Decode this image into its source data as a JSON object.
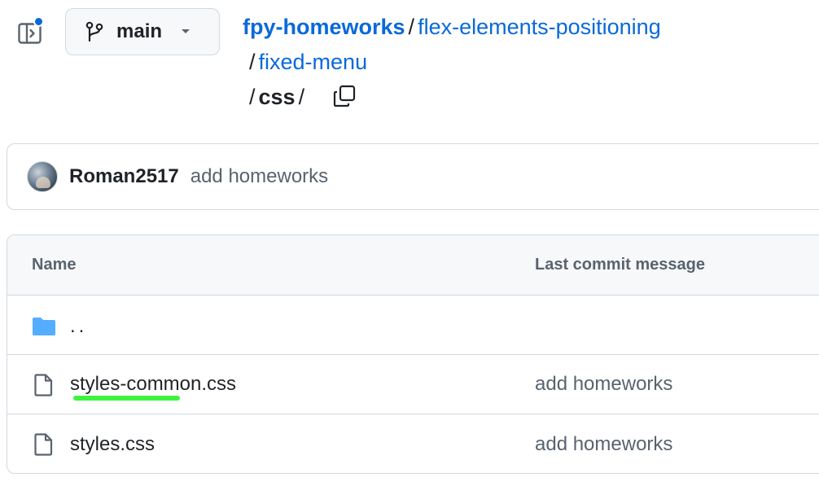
{
  "sidebar_toggle": {
    "icon": "sidebar-expand-icon",
    "indicator_color": "#0969da"
  },
  "branch": {
    "label": "main",
    "icon": "git-branch-icon",
    "caret_icon": "triangle-down-icon"
  },
  "breadcrumb": {
    "repo": "fpy-homeworks",
    "segments": [
      "flex-elements-positioning",
      "fixed-menu"
    ],
    "current": "css",
    "separator": "/",
    "copy_icon": "copy-icon"
  },
  "commit": {
    "author": "Roman2517",
    "message": "add homeworks"
  },
  "table": {
    "headers": {
      "name": "Name",
      "last_commit": "Last commit message"
    },
    "parent": {
      "name": "..",
      "icon": "folder-icon"
    },
    "rows": [
      {
        "name": "styles-common.css",
        "message": "add homeworks",
        "icon": "file-icon",
        "highlighted": true
      },
      {
        "name": "styles.css",
        "message": "add homeworks",
        "icon": "file-icon",
        "highlighted": false
      }
    ]
  },
  "colors": {
    "link": "#0969da",
    "muted": "#59636e",
    "border": "#d1d9e0",
    "folder": "#54aeff",
    "highlight": "#3cf53c"
  }
}
